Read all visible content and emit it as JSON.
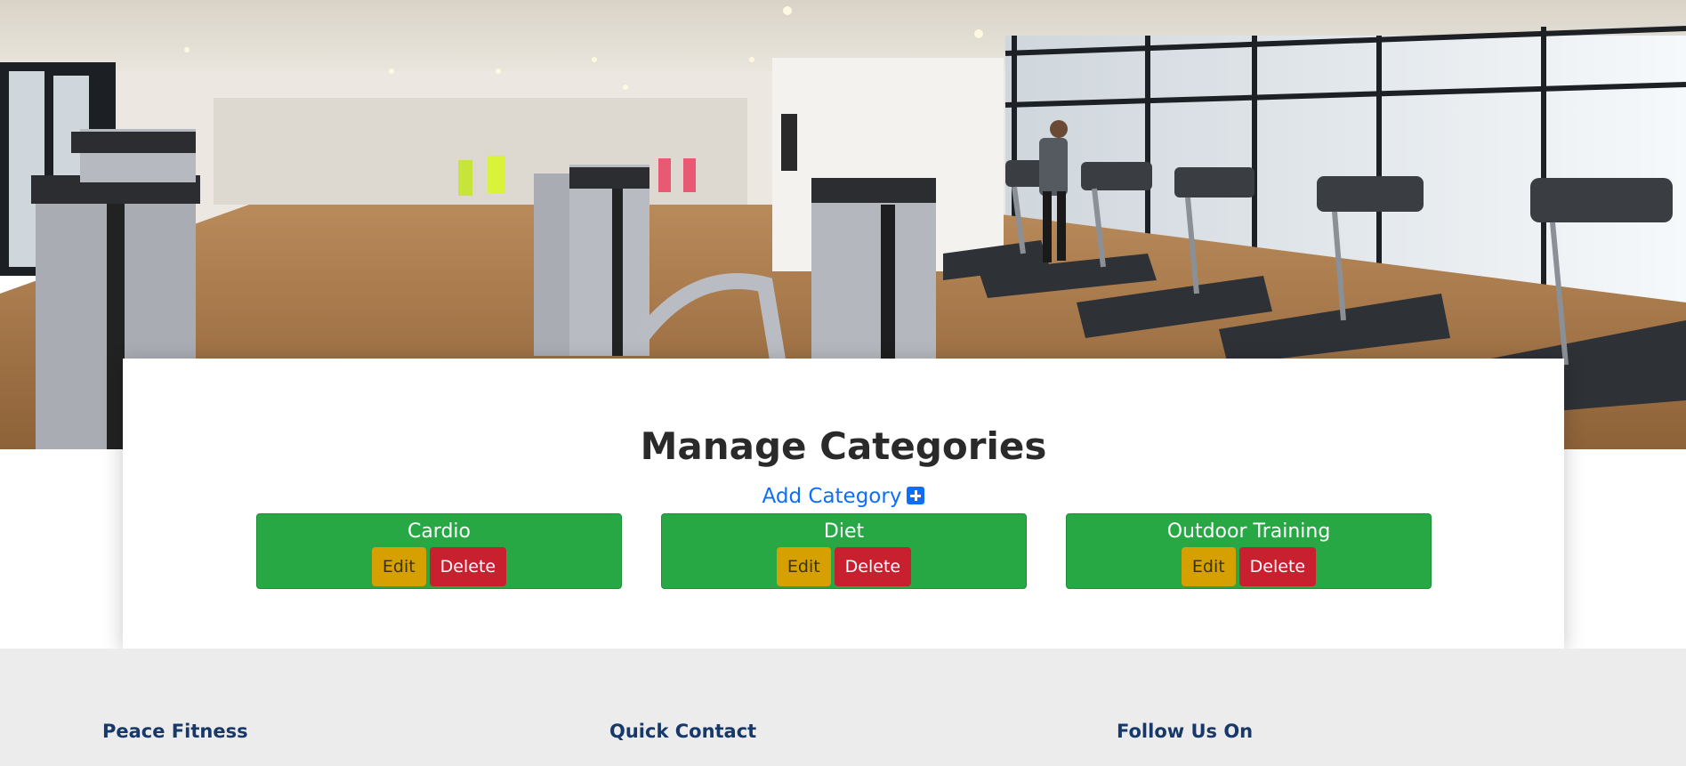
{
  "page": {
    "title": "Manage Categories",
    "add_category_label": "Add Category"
  },
  "categories": [
    {
      "name": "Cardio",
      "edit_label": "Edit",
      "delete_label": "Delete"
    },
    {
      "name": "Diet",
      "edit_label": "Edit",
      "delete_label": "Delete"
    },
    {
      "name": "Outdoor Training",
      "edit_label": "Edit",
      "delete_label": "Delete"
    }
  ],
  "footer": {
    "col1_heading": "Peace Fitness",
    "col2_heading": "Quick Contact",
    "col3_heading": "Follow Us On"
  },
  "colors": {
    "category_bg": "#28a745",
    "edit_bg": "#d6a000",
    "delete_bg": "#c8202f",
    "link": "#0d6efd",
    "footer_heading": "#16386b",
    "footer_bg": "#ececec"
  },
  "icons": {
    "add_category": "plus-square-icon"
  }
}
